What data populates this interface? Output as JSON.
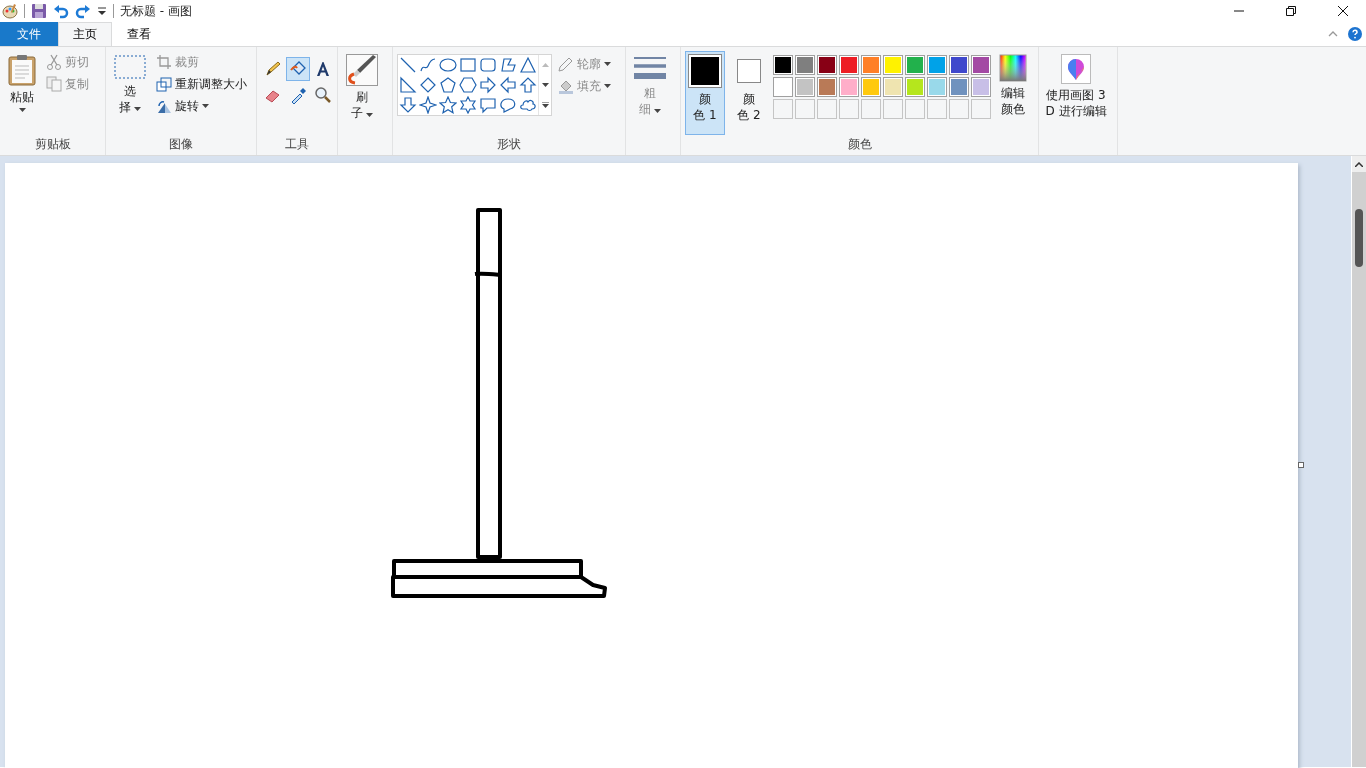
{
  "window": {
    "title": "无标题 - 画图"
  },
  "tabs": [
    {
      "label": "文件",
      "kind": "file",
      "selected": false
    },
    {
      "label": "主页",
      "kind": "tab",
      "selected": true
    },
    {
      "label": "查看",
      "kind": "tab",
      "selected": false
    }
  ],
  "clipboard": {
    "label": "剪贴板",
    "paste": {
      "lines": [
        "粘贴"
      ]
    },
    "actions": [
      {
        "label": "剪切",
        "kind": "cut",
        "disabled": true
      },
      {
        "label": "复制",
        "kind": "copy",
        "disabled": true
      }
    ]
  },
  "image": {
    "label": "图像",
    "select": {
      "lines": [
        "选",
        "择"
      ]
    },
    "actions": [
      {
        "label": "裁剪",
        "kind": "crop",
        "disabled": true
      },
      {
        "label": "重新调整大小",
        "kind": "resize",
        "disabled": false
      },
      {
        "label": "旋转",
        "kind": "rotate",
        "disabled": false
      }
    ]
  },
  "tools": {
    "label": "工具",
    "items": [
      {
        "kind": "pencil",
        "selected": false
      },
      {
        "kind": "fill",
        "selected": true
      },
      {
        "kind": "text",
        "selected": false
      },
      {
        "kind": "eraser",
        "selected": false
      },
      {
        "kind": "picker",
        "selected": false
      },
      {
        "kind": "magnifier",
        "selected": false
      }
    ]
  },
  "brushes": {
    "lines": [
      "刷",
      "子"
    ]
  },
  "shapes": {
    "label": "形状",
    "outline": {
      "label": "轮廓",
      "disabled": true
    },
    "fill": {
      "label": "填充",
      "disabled": true
    }
  },
  "size": {
    "lines": [
      "粗",
      "细"
    ],
    "disabled": true
  },
  "colors": {
    "label": "颜色",
    "color1": {
      "lines": [
        "颜",
        "色 1"
      ],
      "color": "#000000",
      "selected": true
    },
    "color2": {
      "lines": [
        "颜",
        "色 2"
      ],
      "color": "#ffffff",
      "selected": false
    },
    "palette": [
      {
        "color": "#000000"
      },
      {
        "color": "#7f7f7f"
      },
      {
        "color": "#880015"
      },
      {
        "color": "#ed1c24"
      },
      {
        "color": "#ff7f27"
      },
      {
        "color": "#fff200"
      },
      {
        "color": "#22b14c"
      },
      {
        "color": "#00a2e8"
      },
      {
        "color": "#3f48cc"
      },
      {
        "color": "#a349a4"
      },
      {
        "color": "#ffffff"
      },
      {
        "color": "#c3c3c3"
      },
      {
        "color": "#b97a57"
      },
      {
        "color": "#ffaec9"
      },
      {
        "color": "#ffc90e"
      },
      {
        "color": "#efe4b0"
      },
      {
        "color": "#b5e61d"
      },
      {
        "color": "#99d9ea"
      },
      {
        "color": "#7092be"
      },
      {
        "color": "#c8bfe7"
      }
    ],
    "edit": {
      "lines": [
        "编辑",
        "颜色"
      ]
    }
  },
  "paint3d": {
    "lines": [
      "使用画图 3",
      "D 进行编辑"
    ]
  }
}
